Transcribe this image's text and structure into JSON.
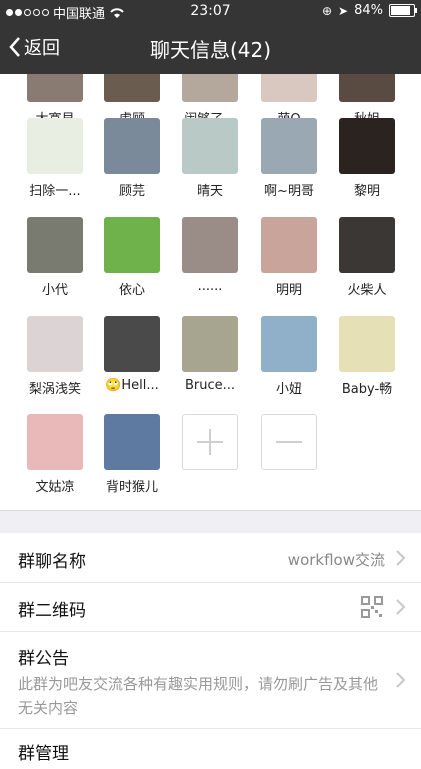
{
  "status_bar": {
    "carrier": "中国联通",
    "time": "23:07",
    "battery": "84%"
  },
  "nav": {
    "back_label": "返回",
    "title": "聊天信息(42)"
  },
  "members": [
    {
      "name": "大寞貝",
      "bg": "#8a7b72"
    },
    {
      "name": "虐顾",
      "bg": "#6a5d50"
    },
    {
      "name": "闹够了...",
      "bg": "#b4a89c"
    },
    {
      "name": "萌Q",
      "bg": "#d9c8c0"
    },
    {
      "name": "秋姐",
      "bg": "#5a4b42"
    },
    {
      "name": "扫除一...",
      "bg": "#e8efe2"
    },
    {
      "name": "顾芫",
      "bg": "#7b8a9a"
    },
    {
      "name": "晴天",
      "bg": "#b9c9c6"
    },
    {
      "name": "啊~明哥",
      "bg": "#9aa8b4"
    },
    {
      "name": "黎明",
      "bg": "#2a2320"
    },
    {
      "name": "小代",
      "bg": "#7a7b70"
    },
    {
      "name": "依心",
      "bg": "#6fb24c"
    },
    {
      "name": "......",
      "bg": "#9a8c86"
    },
    {
      "name": "明明",
      "bg": "#c9a49a"
    },
    {
      "name": "火柴人",
      "bg": "#3b3735"
    },
    {
      "name": "梨涡浅笑",
      "bg": "#dcd4d4"
    },
    {
      "name": "🙄Hell...",
      "bg": "#4a4a4a"
    },
    {
      "name": "Bruce...",
      "bg": "#a7a48f"
    },
    {
      "name": "小妞",
      "bg": "#8fb0c8"
    },
    {
      "name": "Baby-畅",
      "bg": "#e6e0b6"
    },
    {
      "name": "文姑凉",
      "bg": "#e9b8b8"
    },
    {
      "name": "背时猴儿",
      "bg": "#5e7aa0"
    }
  ],
  "settings": {
    "group_name_label": "群聊名称",
    "group_name_value": "workflow交流",
    "qr_label": "群二维码",
    "notice_label": "群公告",
    "notice_text": "此群为吧友交流各种有趣实用规则，请勿刷广告及其他无关内容",
    "manage_label": "群管理"
  },
  "colors": {
    "nav_bg": "#353535",
    "separator_bg": "#efeff4"
  }
}
